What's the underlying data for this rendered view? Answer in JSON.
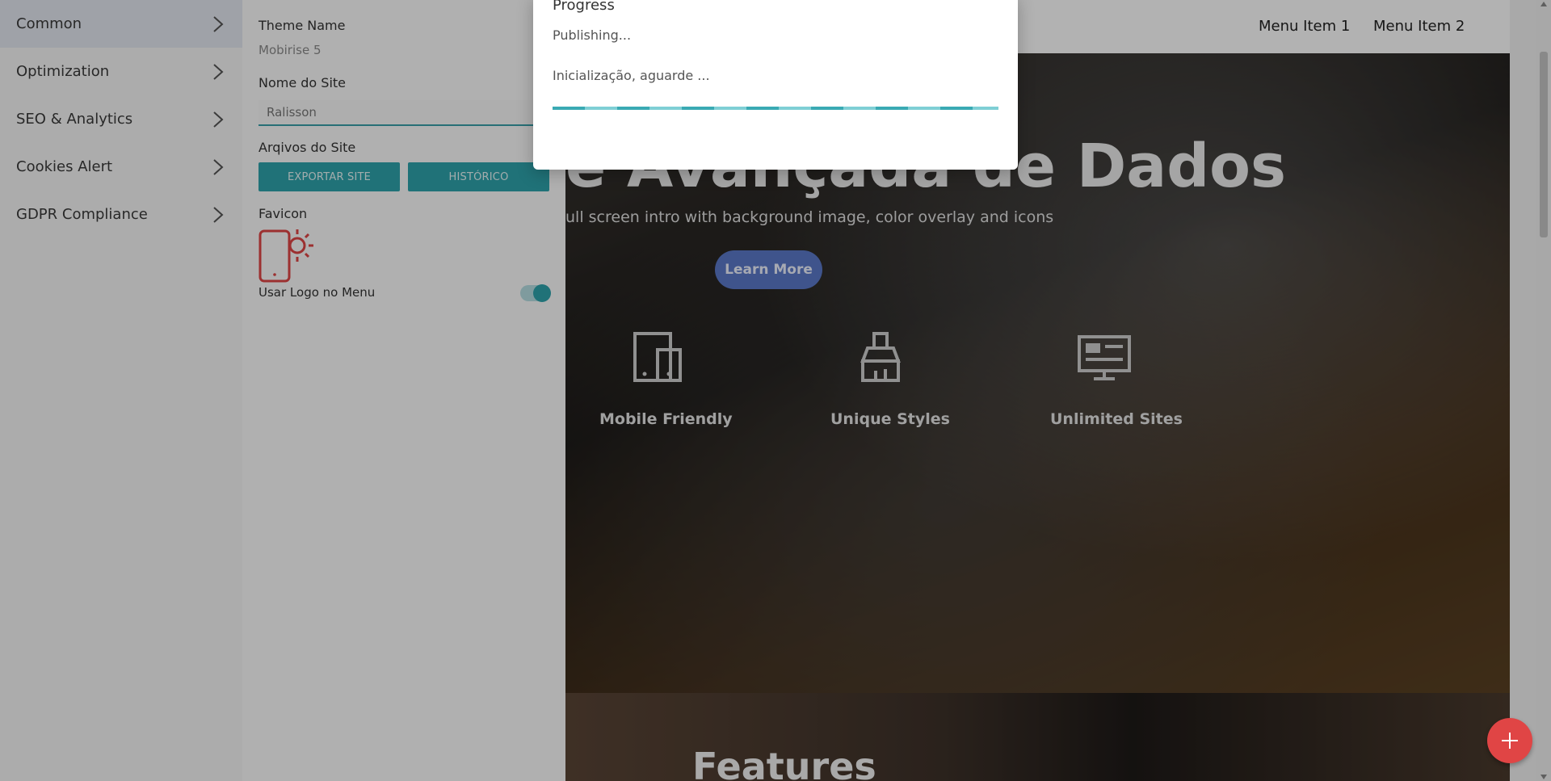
{
  "sidebar": {
    "items": [
      {
        "label": "Common"
      },
      {
        "label": "Optimization"
      },
      {
        "label": "SEO & Analytics"
      },
      {
        "label": "Cookies Alert"
      },
      {
        "label": "GDPR Compliance"
      }
    ]
  },
  "settings": {
    "theme_label": "Theme Name",
    "theme_value": "Mobirise 5",
    "site_name_label": "Nome do Site",
    "site_name_value": "Ralisson",
    "files_label": "Arqivos do Site",
    "export_button": "EXPORTAR SITE",
    "history_button": "HISTÓRICO",
    "favicon_label": "Favicon",
    "use_logo_label": "Usar Logo no Menu",
    "use_logo_enabled": true
  },
  "preview": {
    "menu_items": [
      "Menu Item 1",
      "Menu Item 2"
    ],
    "hero_title": "e Avançada de Dados",
    "hero_subtitle": "ull screen intro with background image, color overlay and icons",
    "learn_more": "Learn More",
    "features": [
      {
        "label": "Mobile Friendly",
        "icon": "mobile-devices-icon"
      },
      {
        "label": "Unique Styles",
        "icon": "paint-brush-icon"
      },
      {
        "label": "Unlimited Sites",
        "icon": "website-icon"
      }
    ],
    "features_heading": "Features"
  },
  "modal": {
    "title": "Progress",
    "status": "Publishing...",
    "message": "Inicialização, aguarde ..."
  },
  "colors": {
    "accent": "#2fa4ad",
    "fab": "#e04545",
    "learn_more": "#5b79c9"
  }
}
